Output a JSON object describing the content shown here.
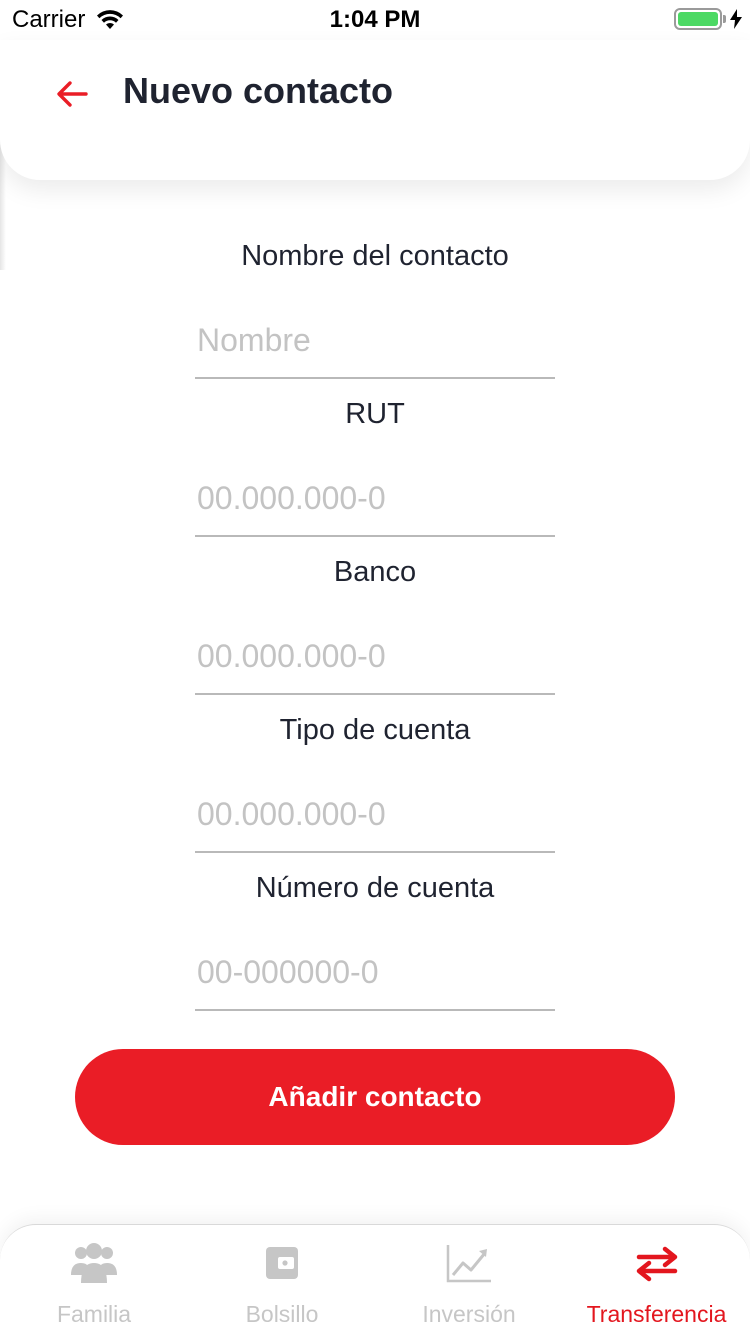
{
  "status_bar": {
    "carrier": "Carrier",
    "time": "1:04 PM",
    "icons": [
      "wifi-icon",
      "battery-icon",
      "charging-bolt-icon"
    ]
  },
  "header": {
    "back_icon": "arrow-left-icon",
    "title": "Nuevo contacto"
  },
  "form": {
    "fields": [
      {
        "label": "Nombre del contacto",
        "placeholder": "Nombre",
        "value": ""
      },
      {
        "label": "RUT",
        "placeholder": "00.000.000-0",
        "value": ""
      },
      {
        "label": "Banco",
        "placeholder": "00.000.000-0",
        "value": ""
      },
      {
        "label": "Tipo de cuenta",
        "placeholder": "00.000.000-0",
        "value": ""
      },
      {
        "label": "Número de cuenta",
        "placeholder": "00-000000-0",
        "value": ""
      }
    ],
    "submit_label": "Añadir contacto"
  },
  "tab_bar": {
    "tabs": [
      {
        "label": "Familia",
        "icon": "family-icon",
        "active": false
      },
      {
        "label": "Bolsillo",
        "icon": "wallet-icon",
        "active": false
      },
      {
        "label": "Inversión",
        "icon": "chart-line-icon",
        "active": false
      },
      {
        "label": "Transferencia",
        "icon": "transfer-arrows-icon",
        "active": true
      }
    ]
  },
  "colors": {
    "accent": "#ea1d26",
    "active_tab": "#e3161e",
    "inactive_tab": "#c6c6c6",
    "title_text": "#1f2330",
    "placeholder": "#c3c3c3",
    "battery_fill": "#4cd964"
  }
}
